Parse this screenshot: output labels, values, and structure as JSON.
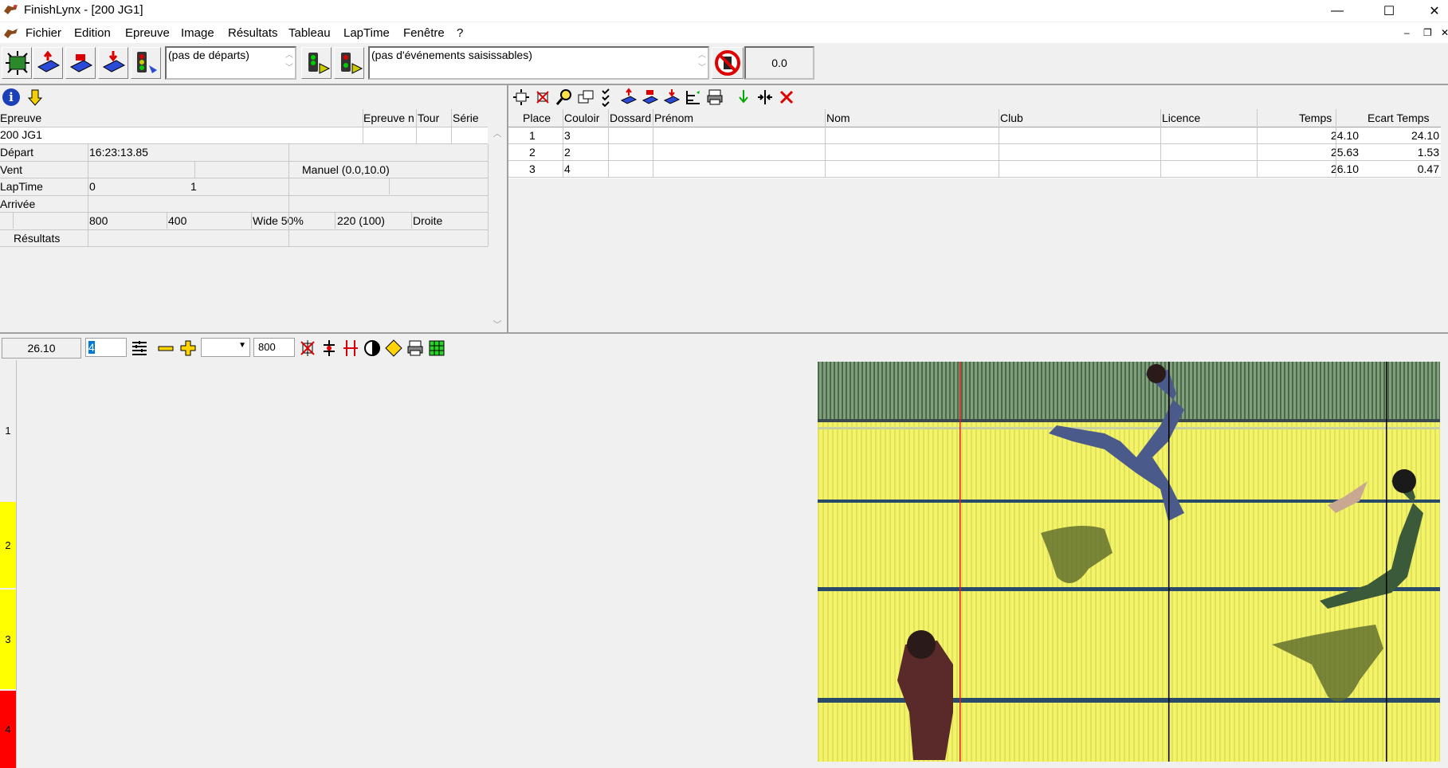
{
  "window": {
    "title": "FinishLynx - [200 JG1]",
    "minimize": "—",
    "maximize": "☐",
    "close": "✕"
  },
  "menu": {
    "items": [
      "Fichier",
      "Edition",
      "Epreuve",
      "Image",
      "Résultats",
      "Tableau",
      "LapTime",
      "Fenêtre",
      "?"
    ],
    "mdi_min": "–",
    "mdi_restore": "❐",
    "mdi_close": "✕"
  },
  "toolbar": {
    "departs_combo": "(pas de départs)",
    "events_combo": "(pas d'événements saisissables)",
    "time_display": "0.0"
  },
  "event_panel": {
    "headers": {
      "epreuve": "Epreuve",
      "epreuve_n": "Epreuve n",
      "tour": "Tour",
      "serie": "Série"
    },
    "event_name": "200 JG1",
    "rows": {
      "depart_label": "Départ",
      "depart_value": "16:23:13.85",
      "vent_label": "Vent",
      "vent_value": "Manuel (0.0,10.0)",
      "laptime_label": "LapTime",
      "laptime_v1": "0",
      "laptime_v2": "1",
      "arrivee_label": "Arrivée",
      "cam_v1": "800",
      "cam_v2": "400",
      "cam_v3": "Wide 50%",
      "cam_v4": "220  (100)",
      "cam_v5": "Droite",
      "resultats_label": "Résultats"
    }
  },
  "results": {
    "headers": [
      "Place",
      "Couloir",
      "Dossard",
      "Prénom",
      "Nom",
      "Club",
      "Licence",
      "Temps",
      "Ecart Temps"
    ],
    "rows": [
      {
        "place": "1",
        "couloir": "3",
        "temps": "24.10",
        "ecart": "24.10"
      },
      {
        "place": "2",
        "couloir": "2",
        "temps": "25.63",
        "ecart": "1.53"
      },
      {
        "place": "3",
        "couloir": "4",
        "temps": "26.10",
        "ecart": "0.47"
      }
    ]
  },
  "image_toolbar": {
    "time": "26.10",
    "lane_field": "4",
    "zoom_field": "800"
  },
  "lanes": [
    "1",
    "2",
    "3",
    "4"
  ],
  "colors": {
    "lane2": "#ffff00",
    "lane3": "#ffff00",
    "lane4": "#ff0000",
    "image_bg": "#f2f26a"
  }
}
